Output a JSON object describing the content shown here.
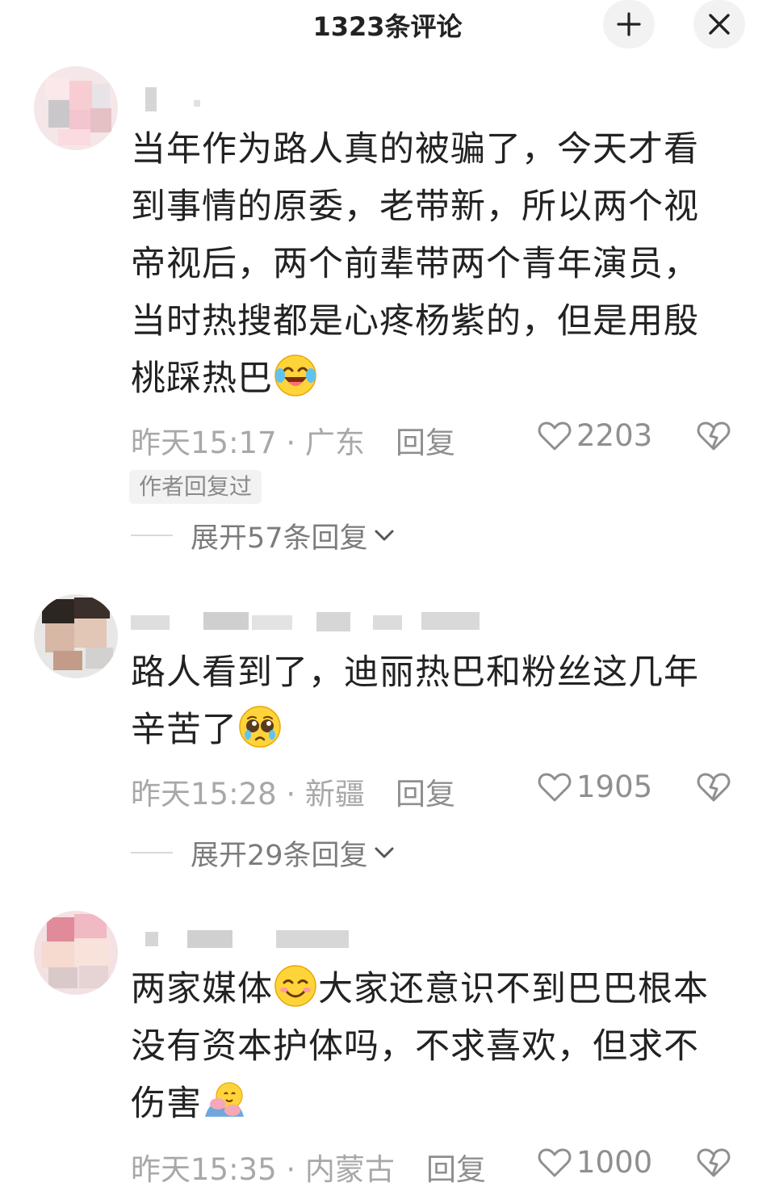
{
  "header": {
    "title": "1323条评论",
    "collapse_icon": "collapse-icon",
    "close_icon": "close-icon"
  },
  "comments": [
    {
      "text_lines": [
        "当年作为路人真的被骗了，今天才看",
        "到事情的原委，老带新，所以两个视",
        "帝视后，两个前辈带两个青年演员，",
        "当时热搜都是心疼杨紫的，但是用殷",
        "桃踩热巴"
      ],
      "emoji": "laughing-crying-emoji",
      "time": "昨天15:17",
      "location": "广东",
      "time_location": "昨天15:17 · 广东",
      "reply_label": "回复",
      "likes": "2203",
      "author_badge": "作者回复过",
      "expand_label": "展开57条回复"
    },
    {
      "text_lines": [
        "路人看到了，迪丽热巴和粉丝这几年",
        "辛苦了"
      ],
      "emoji": "pleading-face-emoji",
      "time": "昨天15:28",
      "location": "新疆",
      "time_location": "昨天15:28 · 新疆",
      "reply_label": "回复",
      "likes": "1905",
      "expand_label": "展开29条回复"
    },
    {
      "text_line1_before": "两家媒体",
      "text_line1_after": "大家还意识不到巴巴根本",
      "text_lines": [
        "没有资本护体吗，不求喜欢，但求不",
        "伤害"
      ],
      "emoji1": "smiling-blush-emoji",
      "emoji2": "hugging-emoji",
      "time": "昨天15:35",
      "location": "内蒙古",
      "time_location": "昨天15:35 · 内蒙古",
      "reply_label": "回复",
      "likes": "1000"
    }
  ],
  "colors": {
    "text": "#222222",
    "meta": "#a8a8a8",
    "button_bg": "#f2f2f2"
  }
}
